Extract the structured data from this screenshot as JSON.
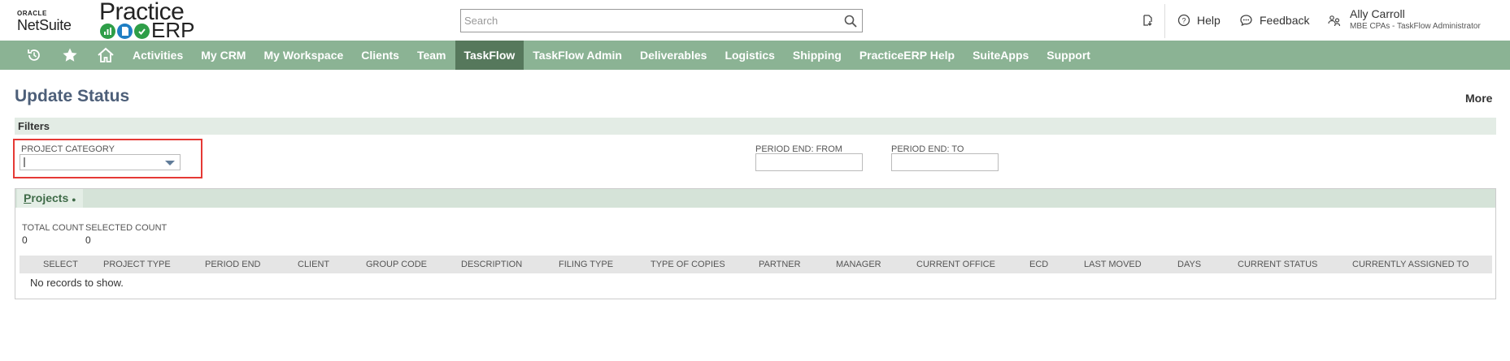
{
  "header": {
    "netsuite_oracle": "ORACLE",
    "netsuite_name": "NetSuite",
    "practice_top": "Practice",
    "practice_bottom": "ERP",
    "search_placeholder": "Search",
    "help_label": "Help",
    "feedback_label": "Feedback",
    "user_name": "Ally Carroll",
    "user_role": "MBE CPAs - TaskFlow Administrator"
  },
  "nav": {
    "items": [
      {
        "label": "Activities"
      },
      {
        "label": "My CRM"
      },
      {
        "label": "My Workspace"
      },
      {
        "label": "Clients"
      },
      {
        "label": "Team"
      },
      {
        "label": "TaskFlow"
      },
      {
        "label": "TaskFlow Admin"
      },
      {
        "label": "Deliverables"
      },
      {
        "label": "Logistics"
      },
      {
        "label": "Shipping"
      },
      {
        "label": "PracticeERP Help"
      },
      {
        "label": "SuiteApps"
      },
      {
        "label": "Support"
      }
    ],
    "active": "TaskFlow",
    "bar_color": "#8bb394",
    "active_color": "#56785c"
  },
  "page": {
    "title": "Update Status",
    "more_label": "More"
  },
  "filters": {
    "title": "Filters",
    "project_category_label": "PROJECT CATEGORY",
    "project_category_value": "",
    "period_end_from_label": "PERIOD END: FROM",
    "period_end_from_value": "",
    "period_end_to_label": "PERIOD END: TO",
    "period_end_to_value": ""
  },
  "projects": {
    "tab_first_letter": "P",
    "tab_rest": "rojects",
    "tab_dot": "●",
    "total_count_label": "TOTAL COUNT",
    "total_count_value": "0",
    "selected_count_label": "SELECTED COUNT",
    "selected_count_value": "0",
    "columns": [
      "SELECT",
      "PROJECT TYPE",
      "PERIOD END",
      "CLIENT",
      "GROUP CODE",
      "DESCRIPTION",
      "FILING TYPE",
      "TYPE OF COPIES",
      "PARTNER",
      "MANAGER",
      "CURRENT OFFICE",
      "ECD",
      "LAST MOVED",
      "DAYS",
      "CURRENT STATUS",
      "CURRENTLY ASSIGNED TO"
    ],
    "empty_message": "No records to show."
  },
  "colors": {
    "title": "#4d5f79",
    "highlight": "#e53935"
  }
}
